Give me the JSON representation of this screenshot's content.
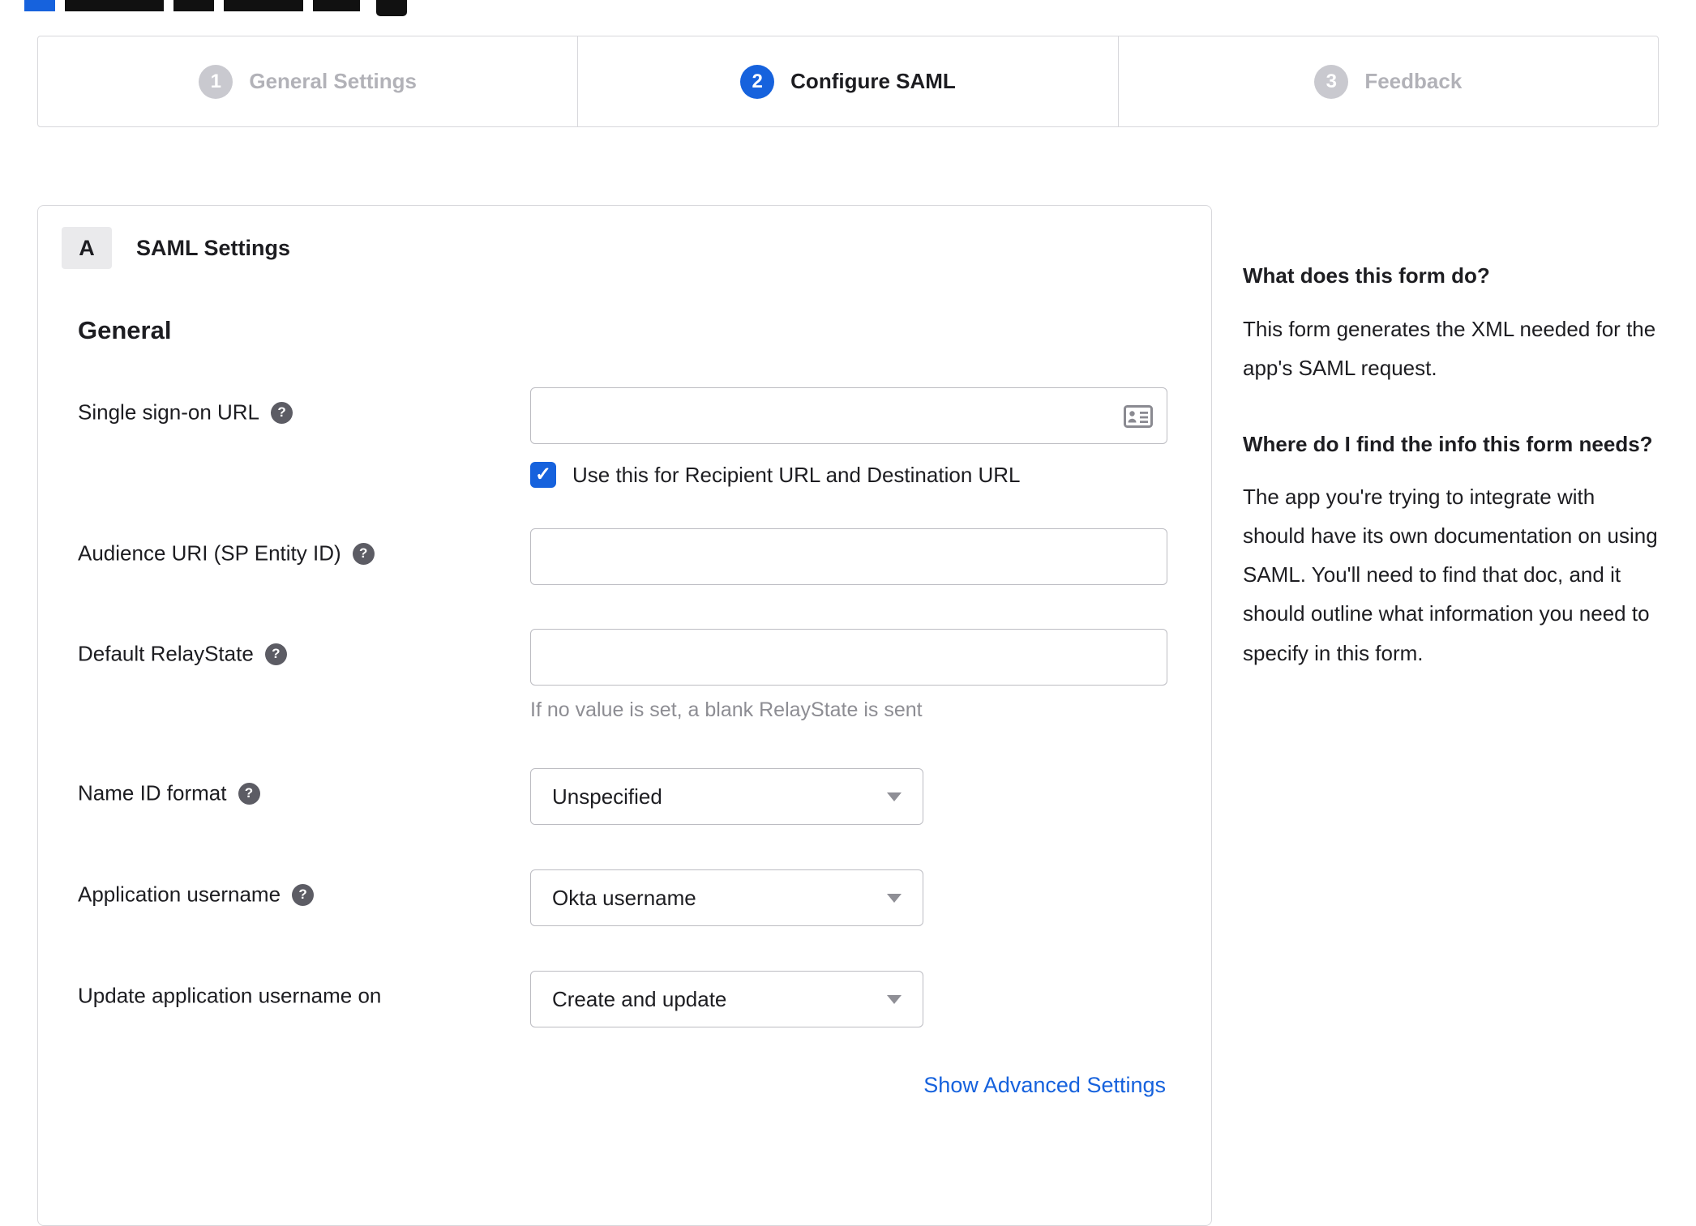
{
  "accent": "#1662dd",
  "stepper": {
    "steps": [
      {
        "number": "1",
        "label": "General Settings"
      },
      {
        "number": "2",
        "label": "Configure SAML"
      },
      {
        "number": "3",
        "label": "Feedback"
      }
    ]
  },
  "panel": {
    "section_badge": "A",
    "section_title": "SAML Settings",
    "group_title": "General",
    "fields": {
      "sso": {
        "label": "Single sign-on URL",
        "value": "",
        "checkbox_label": "Use this for Recipient URL and Destination URL",
        "checked": true
      },
      "audience": {
        "label": "Audience URI (SP Entity ID)",
        "value": ""
      },
      "relay": {
        "label": "Default RelayState",
        "value": "",
        "hint": "If no value is set, a blank RelayState is sent"
      },
      "nameid": {
        "label": "Name ID format",
        "value": "Unspecified"
      },
      "appuser": {
        "label": "Application username",
        "value": "Okta username"
      },
      "update": {
        "label": "Update application username on",
        "value": "Create and update"
      }
    },
    "advanced_link": "Show Advanced Settings"
  },
  "sidebar": {
    "q1": "What does this form do?",
    "a1": "This form generates the XML needed for the app's SAML request.",
    "q2": "Where do I find the info this form needs?",
    "a2": "The app you're trying to integrate with should have its own documentation on using SAML. You'll need to find that doc, and it should outline what information you need to specify in this form."
  }
}
